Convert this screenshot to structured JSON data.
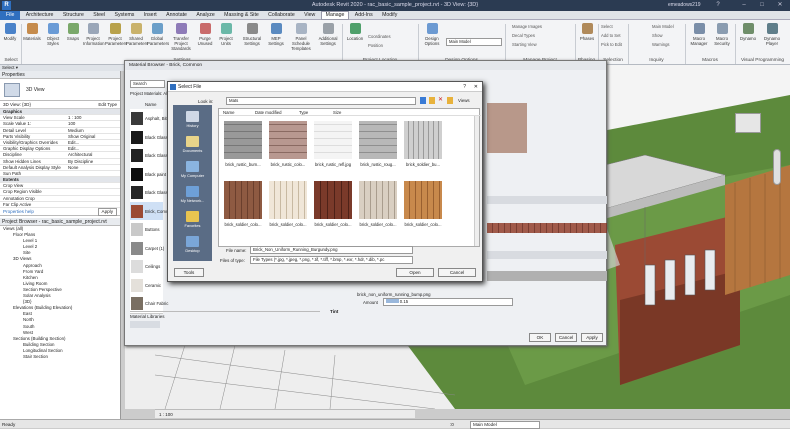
{
  "colors": {
    "accent": "#2f6fbf",
    "titlebar": "#2b3b52",
    "brick": "#9b4a34",
    "wood": "#b5763f"
  },
  "app": {
    "title": "Autodesk Revit 2020 - rac_basic_sample_project.rvt - 3D View: {3D}",
    "user": "emeadows219",
    "help_icon": "?"
  },
  "menu": [
    "File",
    "Architecture",
    "Structure",
    "Steel",
    "Systems",
    "Insert",
    "Annotate",
    "Analyze",
    "Massing & Site",
    "Collaborate",
    "View",
    "Manage",
    "Add-Ins",
    "Modify"
  ],
  "ribbon": {
    "buttons": [
      "Modify",
      "Materials",
      "Object Styles",
      "Snaps",
      "Project Information",
      "Project Parameters",
      "Shared Parameters",
      "Global Parameters",
      "Transfer Project Standards",
      "Purge Unused",
      "Project Units",
      "Structural Settings",
      "MEP Settings",
      "Panel Schedule Templates",
      "Additional Settings",
      "Location",
      "Coordinates",
      "Position",
      "Design Options",
      "Main Model",
      "Manage Images",
      "Decal Types",
      "Starting View",
      "Phases",
      "Select",
      "Add to Set",
      "Pick to Edit",
      "Main Model",
      "Show",
      "Warnings",
      "Macro Manager",
      "Macro Security",
      "Dynamo",
      "Dynamo Player"
    ],
    "groups": [
      "Select",
      "Settings",
      "Project Location",
      "Design Options",
      "Manage Project",
      "Phasing",
      "Selection",
      "Inquiry",
      "Macros",
      "Visual Programming"
    ],
    "select_label": "Select ▾"
  },
  "properties": {
    "header": "Properties",
    "type": "3D View",
    "selector": "3D View: {3D}",
    "edit_type": "Edit Type",
    "rows": [
      {
        "k": "Graphics",
        "v": "",
        "sec": true
      },
      {
        "k": "View Scale",
        "v": "1 : 100"
      },
      {
        "k": "Scale Value 1:",
        "v": "100"
      },
      {
        "k": "Detail Level",
        "v": "Medium"
      },
      {
        "k": "Parts Visibility",
        "v": "Show Original"
      },
      {
        "k": "Visibility/Graphics Overrides",
        "v": "Edit..."
      },
      {
        "k": "Graphic Display Options",
        "v": "Edit..."
      },
      {
        "k": "Discipline",
        "v": "Architectural"
      },
      {
        "k": "Show Hidden Lines",
        "v": "By Discipline"
      },
      {
        "k": "Default Analysis Display Style",
        "v": "None"
      },
      {
        "k": "Sun Path",
        "v": ""
      },
      {
        "k": "Extents",
        "v": "",
        "sec": true
      },
      {
        "k": "Crop View",
        "v": ""
      },
      {
        "k": "Crop Region Visible",
        "v": ""
      },
      {
        "k": "Annotation Crop",
        "v": ""
      },
      {
        "k": "Far Clip Active",
        "v": ""
      }
    ],
    "help": "Properties help",
    "apply": "Apply"
  },
  "browser": {
    "header": "Project Browser - rac_basic_sample_project.rvt",
    "items": [
      {
        "t": "Views (all)",
        "l": 0
      },
      {
        "t": "Floor Plans",
        "l": 1
      },
      {
        "t": "Level 1",
        "l": 2
      },
      {
        "t": "Level 2",
        "l": 2
      },
      {
        "t": "Site",
        "l": 2
      },
      {
        "t": "3D Views",
        "l": 1
      },
      {
        "t": "Approach",
        "l": 2
      },
      {
        "t": "From Yard",
        "l": 2
      },
      {
        "t": "Kitchen",
        "l": 2
      },
      {
        "t": "Living Room",
        "l": 2
      },
      {
        "t": "Section Perspective",
        "l": 2
      },
      {
        "t": "Solar Analysis",
        "l": 2
      },
      {
        "t": "{3D}",
        "l": 2
      },
      {
        "t": "Elevations (Building Elevation)",
        "l": 1
      },
      {
        "t": "East",
        "l": 2
      },
      {
        "t": "North",
        "l": 2
      },
      {
        "t": "South",
        "l": 2
      },
      {
        "t": "West",
        "l": 2
      },
      {
        "t": "Sections (Building Section)",
        "l": 1
      },
      {
        "t": "Building Section",
        "l": 2
      },
      {
        "t": "Longitudinal Section",
        "l": 2
      },
      {
        "t": "Stair Section",
        "l": 2
      }
    ]
  },
  "material_browser": {
    "title": "Material Browser - Brick, Common",
    "search_placeholder": "Search",
    "project_materials": "Project Materials: All",
    "name_col": "Name",
    "materials": [
      "Asphalt, Bitumen",
      "Black Glass",
      "Black Glass",
      "Black paint",
      "Black Glass",
      "Brick, Common",
      "Buttons",
      "Carpet (1)",
      "Ceilings",
      "Ceramic",
      "Chair Fabric"
    ],
    "libraries": "Material Libraries",
    "image_file": "brick_non_uniform_running_bump.png",
    "amount_label": "Amount",
    "amount_value": "0.15",
    "tint_label": "Tint",
    "ok": "OK",
    "cancel": "Cancel",
    "apply": "Apply"
  },
  "select_file": {
    "title": "Select File",
    "look_in_label": "Look in:",
    "look_in_value": "Mats",
    "view_label": "Views",
    "columns": [
      "Name",
      "Date modified",
      "Type",
      "Size"
    ],
    "files": [
      "brick_rustic_burn...",
      "brick_rustic_colo...",
      "brick_rustic_refl.jpg",
      "brick_rustic_roug...",
      "brick_soldier_bu...",
      "brick_soldier_colo...",
      "brick_soldier_colo...",
      "brick_soldier_colo...",
      "brick_soldier_colo...",
      "brick_soldier_colo..."
    ],
    "places": [
      "History",
      "Documents",
      "My Computer",
      "My Network...",
      "Favorites",
      "Desktop"
    ],
    "file_name_label": "File name:",
    "file_name_value": "Brick_Non_Uniform_Running_Burgundy.png",
    "file_type_label": "Files of type:",
    "file_type_value": "File Types (*.jpg, *.jpeg, *.png, *.tif, *.tiff, *.bmp, *.exr, *.hdr, *.dib, *.pc",
    "tools": "Tools",
    "open": "Open",
    "cancel": "Cancel",
    "help_icon": "?",
    "close_icon": "✕"
  },
  "status": {
    "left": "Ready",
    "scale": "1 : 100",
    "model": "Main Model",
    "zero": ":0"
  }
}
